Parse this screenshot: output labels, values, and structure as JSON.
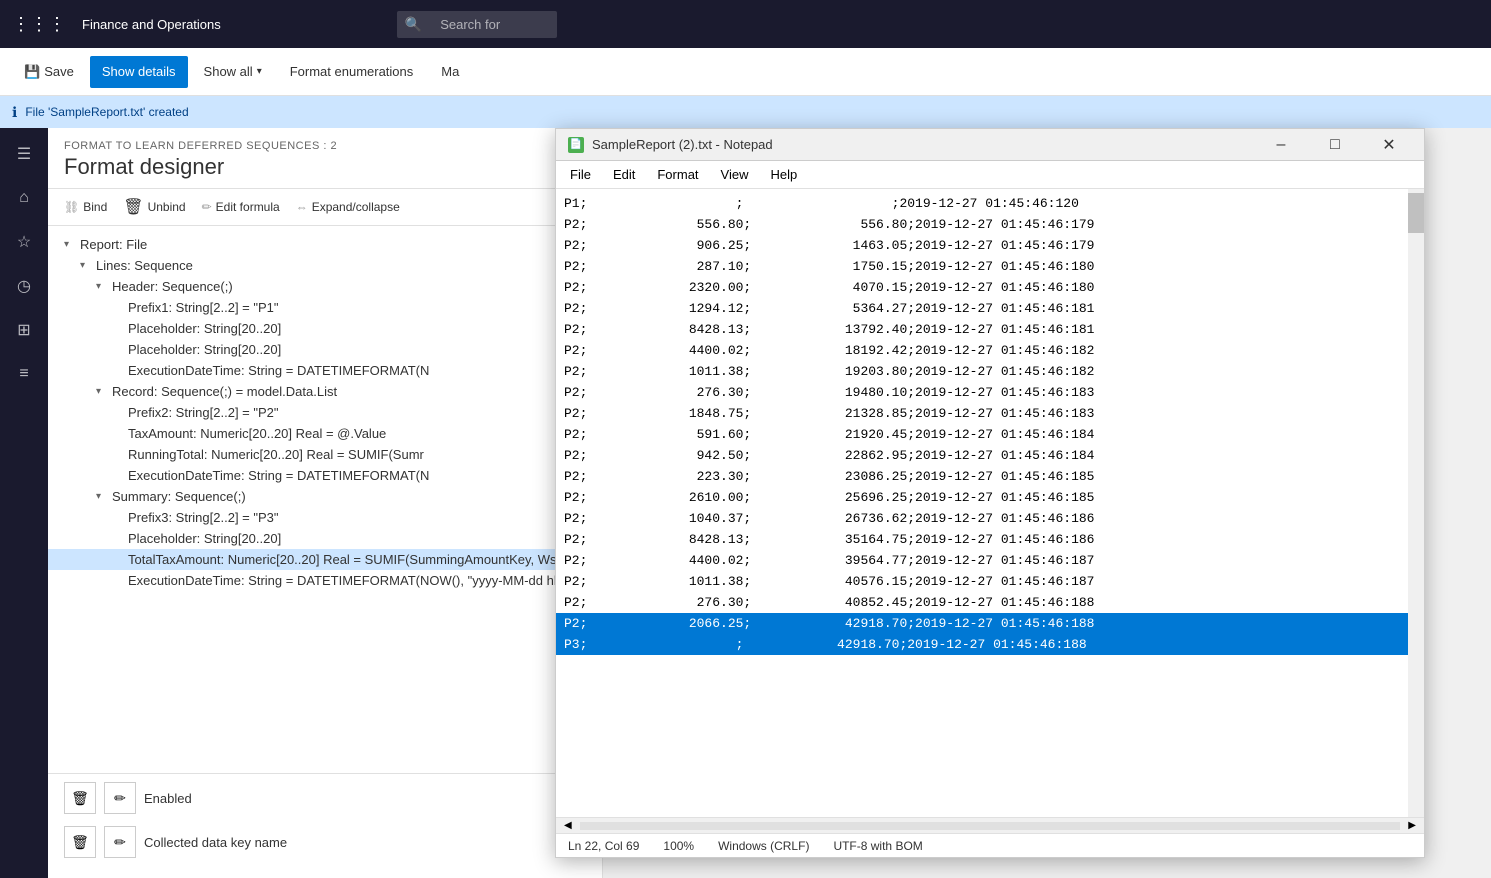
{
  "topbar": {
    "app_title": "Finance and Operations",
    "search_placeholder": "Search for"
  },
  "toolbar": {
    "save_label": "Save",
    "show_details_label": "Show details",
    "show_all_label": "Show all",
    "format_enum_label": "Format enumerations",
    "ma_label": "Ma"
  },
  "infobar": {
    "message": "File 'SampleReport.txt' created"
  },
  "format_designer": {
    "subtitle": "FORMAT TO LEARN DEFERRED SEQUENCES : 2",
    "title": "Format designer",
    "actions": {
      "bind": "Bind",
      "unbind": "Unbind",
      "edit_formula": "Edit formula",
      "expand_collapse": "Expand/collapse"
    },
    "tree": [
      {
        "level": 0,
        "expanded": true,
        "text": "Report: File",
        "indent": 0
      },
      {
        "level": 1,
        "expanded": true,
        "text": "Lines: Sequence",
        "indent": 1
      },
      {
        "level": 2,
        "expanded": true,
        "text": "Header: Sequence(;)",
        "indent": 2
      },
      {
        "level": 3,
        "expanded": false,
        "text": "Prefix1: String[2..2] = \"P1\"",
        "indent": 3
      },
      {
        "level": 3,
        "expanded": false,
        "text": "Placeholder: String[20..20]",
        "indent": 3
      },
      {
        "level": 3,
        "expanded": false,
        "text": "Placeholder: String[20..20]",
        "indent": 3
      },
      {
        "level": 3,
        "expanded": false,
        "text": "ExecutionDateTime: String = DATETIMEFORMAT(N",
        "indent": 3
      },
      {
        "level": 2,
        "expanded": true,
        "text": "Record: Sequence(;) = model.Data.List",
        "indent": 2
      },
      {
        "level": 3,
        "expanded": false,
        "text": "Prefix2: String[2..2] = \"P2\"",
        "indent": 3
      },
      {
        "level": 3,
        "expanded": false,
        "text": "TaxAmount: Numeric[20..20] Real = @.Value",
        "indent": 3
      },
      {
        "level": 3,
        "expanded": false,
        "text": "RunningTotal: Numeric[20..20] Real = SUMIF(Sumr",
        "indent": 3
      },
      {
        "level": 3,
        "expanded": false,
        "text": "ExecutionDateTime: String = DATETIMEFORMAT(N",
        "indent": 3
      },
      {
        "level": 2,
        "expanded": true,
        "text": "Summary: Sequence(;)",
        "indent": 2
      },
      {
        "level": 3,
        "expanded": false,
        "text": "Prefix3: String[2..2] = \"P3\"",
        "indent": 3
      },
      {
        "level": 3,
        "expanded": false,
        "text": "Placeholder: String[20..20]",
        "indent": 3
      },
      {
        "level": 3,
        "expanded": false,
        "text": "TotalTaxAmount: Numeric[20..20] Real = SUMIF(SummingAmountKey, WsColumn, WsRow)",
        "indent": 3,
        "selected": true
      },
      {
        "level": 3,
        "expanded": false,
        "text": "ExecutionDateTime: String = DATETIMEFORMAT(NOW(), \"yyyy-MM-dd hh:mm:ss:fff\")",
        "indent": 3
      }
    ]
  },
  "notepad": {
    "title": "SampleReport (2).txt - Notepad",
    "menu": [
      "File",
      "Edit",
      "Format",
      "View",
      "Help"
    ],
    "lines": [
      {
        "text": "P1;                   ;                   ;2019-12-27 01:45:46:120",
        "selected": false
      },
      {
        "text": "P2;              556.80;              556.80;2019-12-27 01:45:46:179",
        "selected": false
      },
      {
        "text": "P2;              906.25;             1463.05;2019-12-27 01:45:46:179",
        "selected": false
      },
      {
        "text": "P2;              287.10;             1750.15;2019-12-27 01:45:46:180",
        "selected": false
      },
      {
        "text": "P2;             2320.00;             4070.15;2019-12-27 01:45:46:180",
        "selected": false
      },
      {
        "text": "P2;             1294.12;             5364.27;2019-12-27 01:45:46:181",
        "selected": false
      },
      {
        "text": "P2;             8428.13;            13792.40;2019-12-27 01:45:46:181",
        "selected": false
      },
      {
        "text": "P2;             4400.02;            18192.42;2019-12-27 01:45:46:182",
        "selected": false
      },
      {
        "text": "P2;             1011.38;            19203.80;2019-12-27 01:45:46:182",
        "selected": false
      },
      {
        "text": "P2;              276.30;            19480.10;2019-12-27 01:45:46:183",
        "selected": false
      },
      {
        "text": "P2;             1848.75;            21328.85;2019-12-27 01:45:46:183",
        "selected": false
      },
      {
        "text": "P2;              591.60;            21920.45;2019-12-27 01:45:46:184",
        "selected": false
      },
      {
        "text": "P2;              942.50;            22862.95;2019-12-27 01:45:46:184",
        "selected": false
      },
      {
        "text": "P2;              223.30;            23086.25;2019-12-27 01:45:46:185",
        "selected": false
      },
      {
        "text": "P2;             2610.00;            25696.25;2019-12-27 01:45:46:185",
        "selected": false
      },
      {
        "text": "P2;             1040.37;            26736.62;2019-12-27 01:45:46:186",
        "selected": false
      },
      {
        "text": "P2;             8428.13;            35164.75;2019-12-27 01:45:46:186",
        "selected": false
      },
      {
        "text": "P2;             4400.02;            39564.77;2019-12-27 01:45:46:187",
        "selected": false
      },
      {
        "text": "P2;             1011.38;            40576.15;2019-12-27 01:45:46:187",
        "selected": false
      },
      {
        "text": "P2;              276.30;            40852.45;2019-12-27 01:45:46:188",
        "selected": false
      },
      {
        "text": "P2;             2066.25;            42918.70;2019-12-27 01:45:46:188",
        "selected": true
      },
      {
        "text": "P3;                   ;            42918.70;2019-12-27 01:45:46:188",
        "selected": true
      }
    ],
    "statusbar": {
      "position": "Ln 22, Col 69",
      "zoom": "100%",
      "line_ending": "Windows (CRLF)",
      "encoding": "UTF-8 with BOM"
    }
  },
  "bottom_icons": {
    "enabled_label": "Enabled",
    "collected_key_label": "Collected data key name"
  },
  "icons": {
    "grid": "⊞",
    "save": "💾",
    "filter": "⊿",
    "home": "⌂",
    "star": "☆",
    "clock": "🕐",
    "table": "⊞",
    "list": "≡",
    "info": "ℹ",
    "trash": "🗑",
    "pencil": "✏",
    "bind": "⛓",
    "unbind": "✂",
    "formula": "ƒ",
    "expand": "⇔"
  }
}
